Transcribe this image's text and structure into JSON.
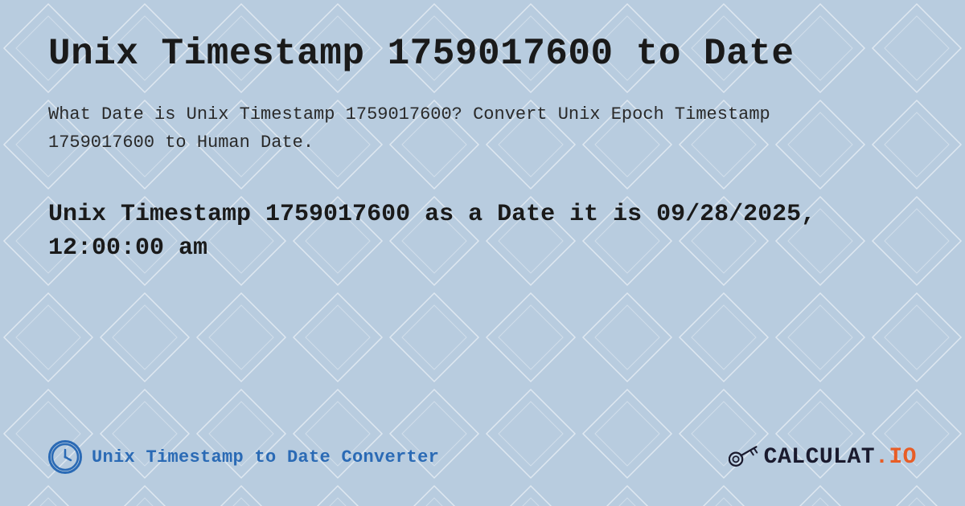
{
  "page": {
    "title": "Unix Timestamp 1759017600 to Date",
    "description": "What Date is Unix Timestamp 1759017600? Convert Unix Epoch Timestamp 1759017600 to Human Date.",
    "result": "Unix Timestamp 1759017600 as a Date it is 09/28/2025, 12:00:00 am"
  },
  "footer": {
    "link_text": "Unix Timestamp to Date Converter",
    "logo_text": "CALCULAT.IO"
  },
  "colors": {
    "background": "#c8d8ee",
    "title_color": "#1a1a1a",
    "accent_blue": "#2a6ab5",
    "logo_color": "#1a1a2e",
    "logo_accent": "#e85d26"
  }
}
